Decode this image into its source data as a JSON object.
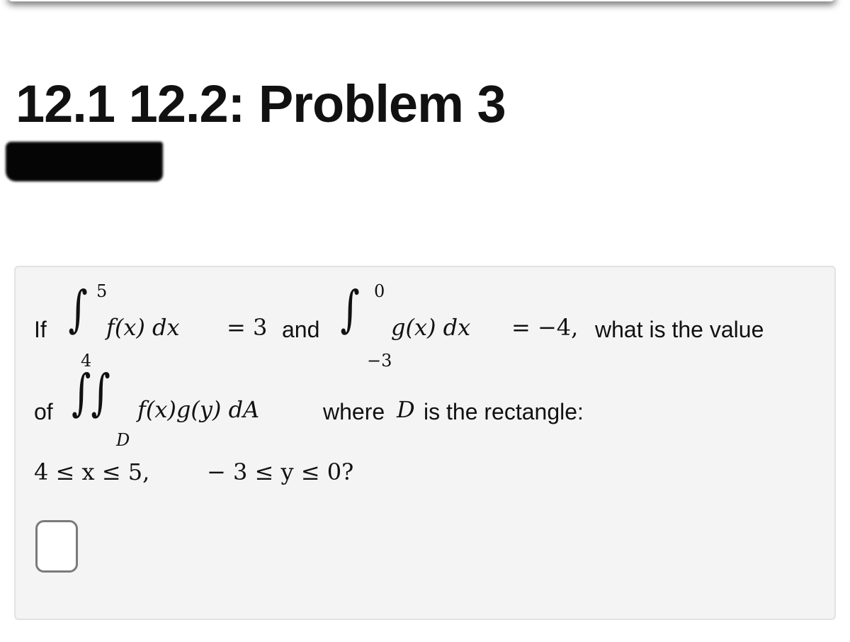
{
  "header": {
    "title": "12.1 12.2: Problem 3",
    "redacted_label": "[redacted]"
  },
  "problem": {
    "line1": {
      "prefix": "If",
      "int1_upper": "5",
      "int1_lower": "4",
      "int1_integrand": "f(x) dx",
      "eq1": "= 3",
      "connector": "and",
      "int2_upper": "0",
      "int2_lower": "−3",
      "int2_integrand": "g(x) dx",
      "eq2": "= −4,",
      "suffix": "what is the value"
    },
    "line2": {
      "prefix": "of",
      "double_int_region": "D",
      "integrand": "f(x)g(y) dA",
      "suffix_text": "where",
      "region_var": "D",
      "suffix_rest": "is the rectangle:"
    },
    "line3": {
      "constraint_x": "4 ≤ x ≤ 5,",
      "constraint_y": "− 3 ≤ y ≤ 0?"
    },
    "answer": {
      "value": ""
    }
  }
}
